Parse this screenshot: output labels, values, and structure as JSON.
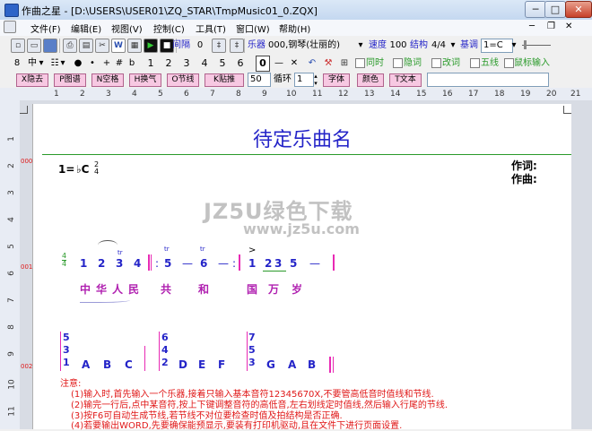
{
  "window": {
    "title": "作曲之星 - [D:\\USERS\\USER01\\ZQ_STAR\\TmpMusic01_0.ZQX]"
  },
  "menu": [
    "文件(F)",
    "编辑(E)",
    "视图(V)",
    "控制(C)",
    "工具(T)",
    "窗口(W)",
    "帮助(H)"
  ],
  "toolbar1": {
    "spacing_label": "间隔",
    "spacing_value": "0",
    "instrument_label": "乐器",
    "instrument_value": "000,钢琴(壮丽的)",
    "speed_label": "速度",
    "speed_value": "100",
    "meter_label": "结构",
    "meter_value": "4/4",
    "key_label": "基调",
    "key_value": "1=C"
  },
  "toolbar2": {
    "size": "8",
    "mid": "中",
    "sharp": "#",
    "flat": "b",
    "digits": [
      "1",
      "2",
      "3",
      "4",
      "5",
      "6",
      "7",
      "0"
    ],
    "dash": "—",
    "cross": "✕",
    "checks": [
      "同时",
      "隐词",
      "改词",
      "五线",
      "鼠标输入"
    ]
  },
  "toolbar3": {
    "buttons": [
      "X隐去",
      "P图谱",
      "N空格",
      "H换气",
      "O节线",
      "K贴推"
    ],
    "num_value": "50",
    "loop_label": "循环",
    "loop_value": "1",
    "font_btn": "字体",
    "color_btn": "颜色",
    "text_btn": "T文本"
  },
  "ruler": {
    "h": [
      "1",
      "2",
      "3",
      "4",
      "5",
      "6",
      "7",
      "8",
      "9",
      "10",
      "11",
      "12",
      "13",
      "14",
      "15",
      "16",
      "17",
      "18",
      "19",
      "20",
      "21"
    ],
    "v": [
      "1",
      "2",
      "3",
      "4",
      "5",
      "6",
      "7",
      "8",
      "9",
      "10",
      "11"
    ]
  },
  "score": {
    "title": "待定乐曲名",
    "key_sig": "1=",
    "key_note": "♭C",
    "time_num": "2",
    "time_den": "4",
    "lyricist_label": "作词:",
    "composer_label": "作曲:",
    "line_num_1": "000",
    "line_num_2": "001",
    "line_num_3": "002",
    "meas1_time_num": "4",
    "meas1_time_den": "4",
    "meas1_notes": [
      "1",
      "2",
      "3",
      "4"
    ],
    "meas2_notes": [
      "5",
      "—",
      "6",
      "—"
    ],
    "meas3_notes": [
      "1",
      "2",
      "3",
      "5",
      "—"
    ],
    "tr_marks": [
      "tr",
      "tr",
      "tr",
      "tr"
    ],
    "lyrics": [
      "中",
      "华",
      "人",
      "民",
      "共",
      "和",
      "国",
      "万",
      "岁"
    ],
    "chord_stacks": [
      [
        "5",
        "3",
        "1"
      ],
      [
        "6",
        "4",
        "2"
      ],
      [
        "7",
        "5",
        "3"
      ]
    ],
    "chord_letters": [
      "A",
      "B",
      "C",
      "D",
      "E",
      "F",
      "G",
      "A",
      "B"
    ]
  },
  "notes": {
    "head": "注意:",
    "lines": [
      "(1)输入时,首先输入一个乐器,接着只输入基本音符12345670X,不要管高低音时值线和节线.",
      "(2)输完一行后,点中某音符,按上下键调整音符的高低音,左右划线定时值线,然后输入行尾的节线.",
      "(3)按F6可自动生成节线,若节线不对位要检查时值及拍结构是否正确.",
      "(4)若要输出WORD,先要确保能预显示,要装有打印机驱动,且在文件下进行页面设置."
    ]
  },
  "watermark": {
    "line1": "JZ5U绿色下载",
    "line2": "www.jz5u.com"
  },
  "colors": {
    "accent": "#2424c8",
    "bar": "#e82ab4",
    "note": "#e01818"
  }
}
